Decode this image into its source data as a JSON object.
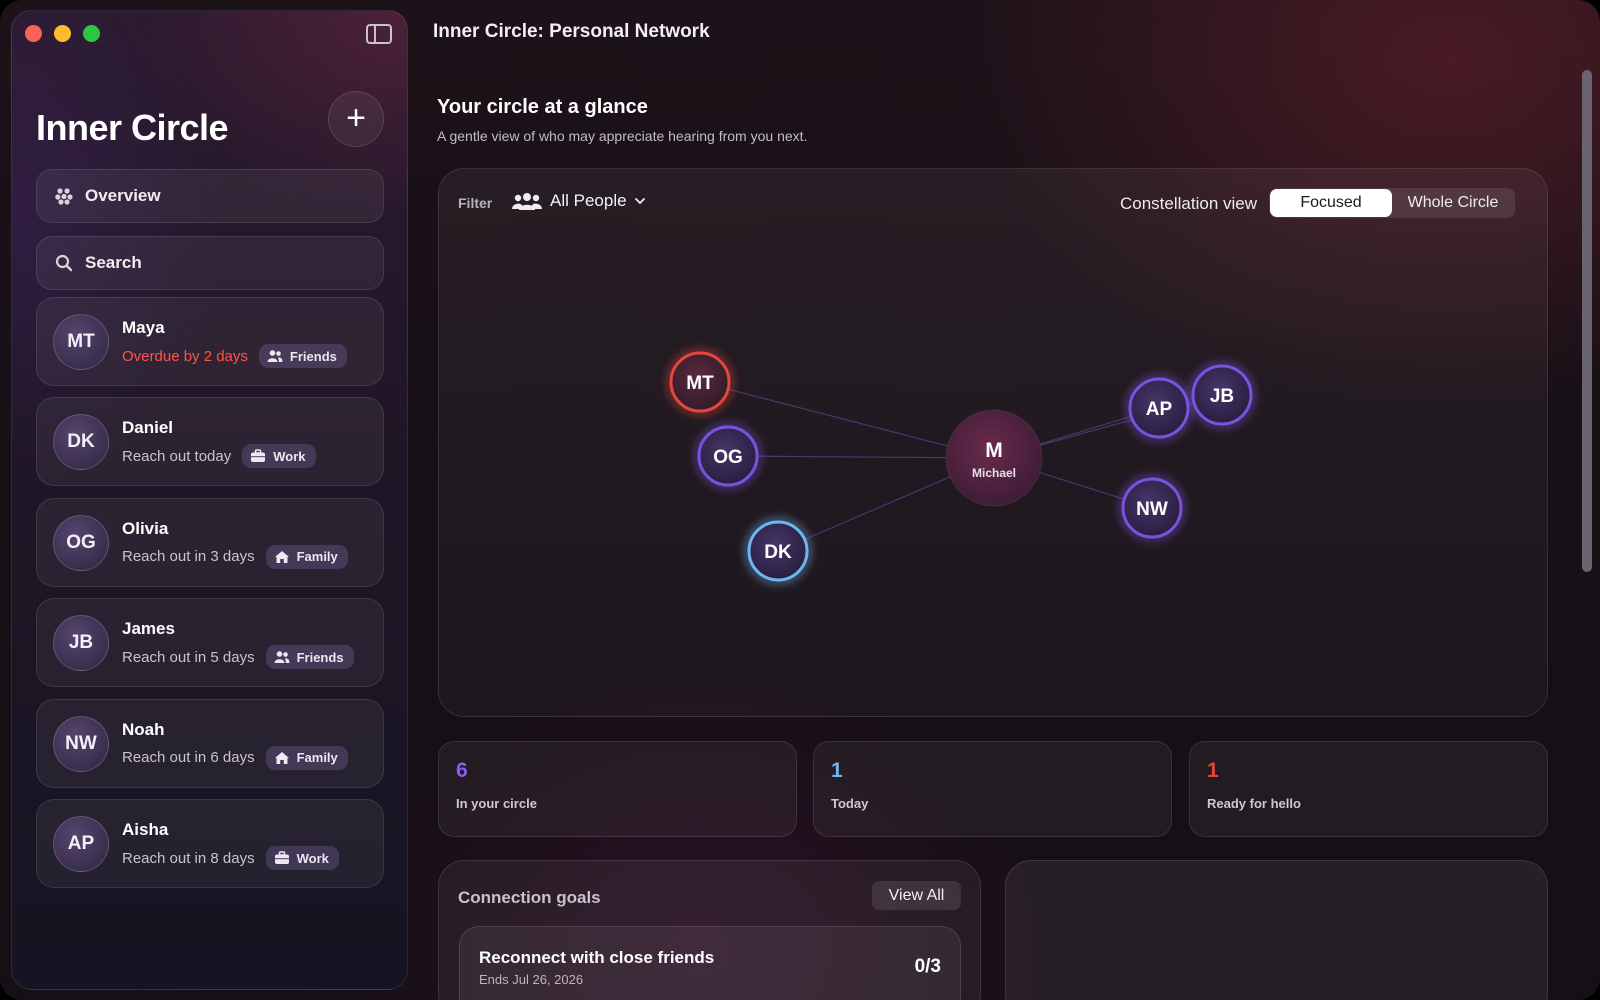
{
  "window": {
    "title": "Inner Circle: Personal Network"
  },
  "sidebar": {
    "title": "Inner Circle",
    "nav": {
      "overview": "Overview",
      "search": "Search"
    },
    "contacts": [
      {
        "initials": "MT",
        "name": "Maya",
        "status": "Overdue by 2 days",
        "overdue": true,
        "tag": "Friends",
        "tag_icon": "people-icon"
      },
      {
        "initials": "DK",
        "name": "Daniel",
        "status": "Reach out today",
        "overdue": false,
        "tag": "Work",
        "tag_icon": "briefcase-icon"
      },
      {
        "initials": "OG",
        "name": "Olivia",
        "status": "Reach out in 3 days",
        "overdue": false,
        "tag": "Family",
        "tag_icon": "house-icon"
      },
      {
        "initials": "JB",
        "name": "James",
        "status": "Reach out in 5 days",
        "overdue": false,
        "tag": "Friends",
        "tag_icon": "people-icon"
      },
      {
        "initials": "NW",
        "name": "Noah",
        "status": "Reach out in 6 days",
        "overdue": false,
        "tag": "Family",
        "tag_icon": "house-icon"
      },
      {
        "initials": "AP",
        "name": "Aisha",
        "status": "Reach out in 8 days",
        "overdue": false,
        "tag": "Work",
        "tag_icon": "briefcase-icon"
      }
    ]
  },
  "main": {
    "section_title": "Your circle at a glance",
    "section_subtitle": "A gentle view of who may appreciate hearing from you next.",
    "filter": {
      "label": "Filter",
      "value": "All People"
    },
    "constellation": {
      "label": "Constellation view",
      "options": [
        "Focused",
        "Whole Circle"
      ],
      "selected": "Focused",
      "center": {
        "initial": "M",
        "name": "Michael"
      },
      "nodes": [
        {
          "initials": "MT",
          "ring_color": "#e8453c"
        },
        {
          "initials": "OG",
          "ring_color": "#7b52e0"
        },
        {
          "initials": "DK",
          "ring_color": "#6fb6f0"
        },
        {
          "initials": "AP",
          "ring_color": "#7b52e0"
        },
        {
          "initials": "JB",
          "ring_color": "#7b52e0"
        },
        {
          "initials": "NW",
          "ring_color": "#7b52e0"
        }
      ]
    },
    "stats": [
      {
        "value": "6",
        "label": "In your circle",
        "color": "#8a5cf0"
      },
      {
        "value": "1",
        "label": "Today",
        "color": "#6fb6f0"
      },
      {
        "value": "1",
        "label": "Ready for hello",
        "color": "#e8453c"
      }
    ],
    "goals": {
      "title": "Connection goals",
      "view_all": "View All",
      "items": [
        {
          "title": "Reconnect with close friends",
          "ends": "Ends Jul 26, 2026",
          "progress": "0/3"
        }
      ]
    }
  }
}
